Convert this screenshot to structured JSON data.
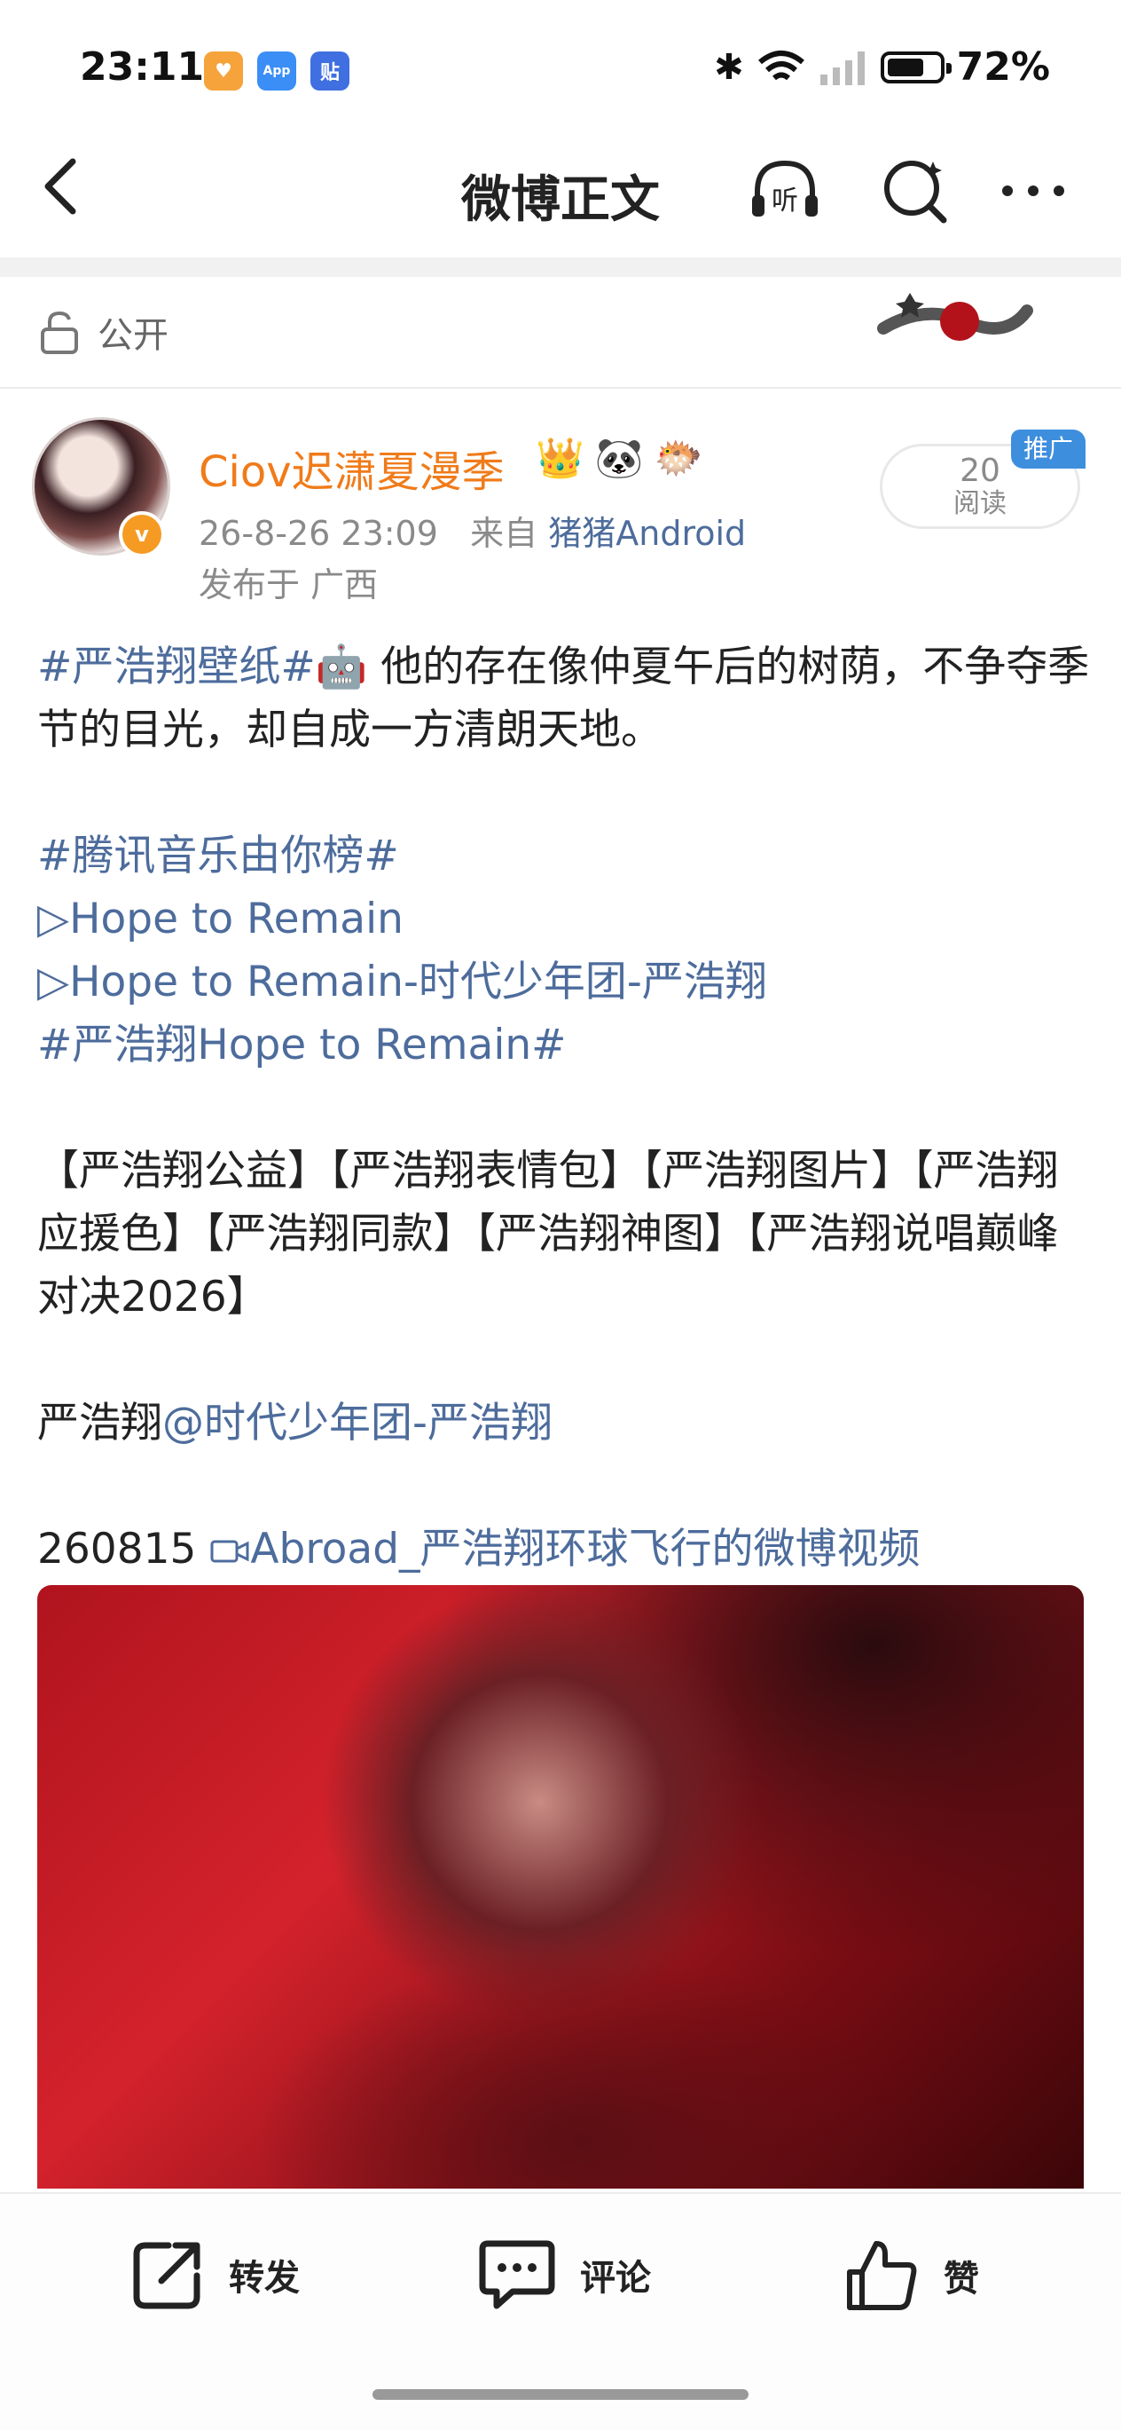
{
  "status_bar": {
    "time": "23:11",
    "app_badges": [
      {
        "icon": "heart-app-icon",
        "color": "#f5a33a",
        "text": "♥"
      },
      {
        "icon": "app-market-icon",
        "color": "#3a8ef5",
        "text": "App"
      },
      {
        "icon": "tieba-icon",
        "color": "#3f6fe0",
        "text": "贴"
      }
    ],
    "battery": "72%",
    "battery_level": 0.72
  },
  "nav": {
    "title": "微博正文"
  },
  "visibility": {
    "label": "公开"
  },
  "author": {
    "name": "Ciov迟潇夏漫季",
    "badges": [
      "👑",
      "🐼",
      "🐡"
    ],
    "timestamp": "26-8-26 23:09",
    "from_label": "来自",
    "source": "猪猪Android",
    "location": "发布于 广西",
    "reads_count": "20",
    "reads_label": "阅读",
    "ad_tag": "推广",
    "verified_mark": "v"
  },
  "post": {
    "line1_tag": "#严浩翔壁纸#",
    "line1_emoji": "🤖",
    "line1_text": " 他的存在像仲夏午后的树荫，不争夺季节的目光，却自成一方清朗天地。",
    "tag2": "#腾讯音乐由你榜#",
    "song1": "▷Hope to Remain",
    "song2": "▷Hope to Remain-时代少年团-严浩翔",
    "tag3": "#严浩翔Hope to Remain#",
    "brackets": "【严浩翔公益】【严浩翔表情包】【严浩翔图片】【严浩翔应援色】【严浩翔同款】【严浩翔神图】【严浩翔说唱巅峰对决2026】",
    "mention_prefix": "严浩翔",
    "mention": "@时代少年团-严浩翔",
    "video_prefix": "260815 ",
    "video_link": "Abroad_严浩翔环球飞行的微博视频"
  },
  "actions": {
    "repost": "转发",
    "comment": "评论",
    "like": "赞"
  }
}
